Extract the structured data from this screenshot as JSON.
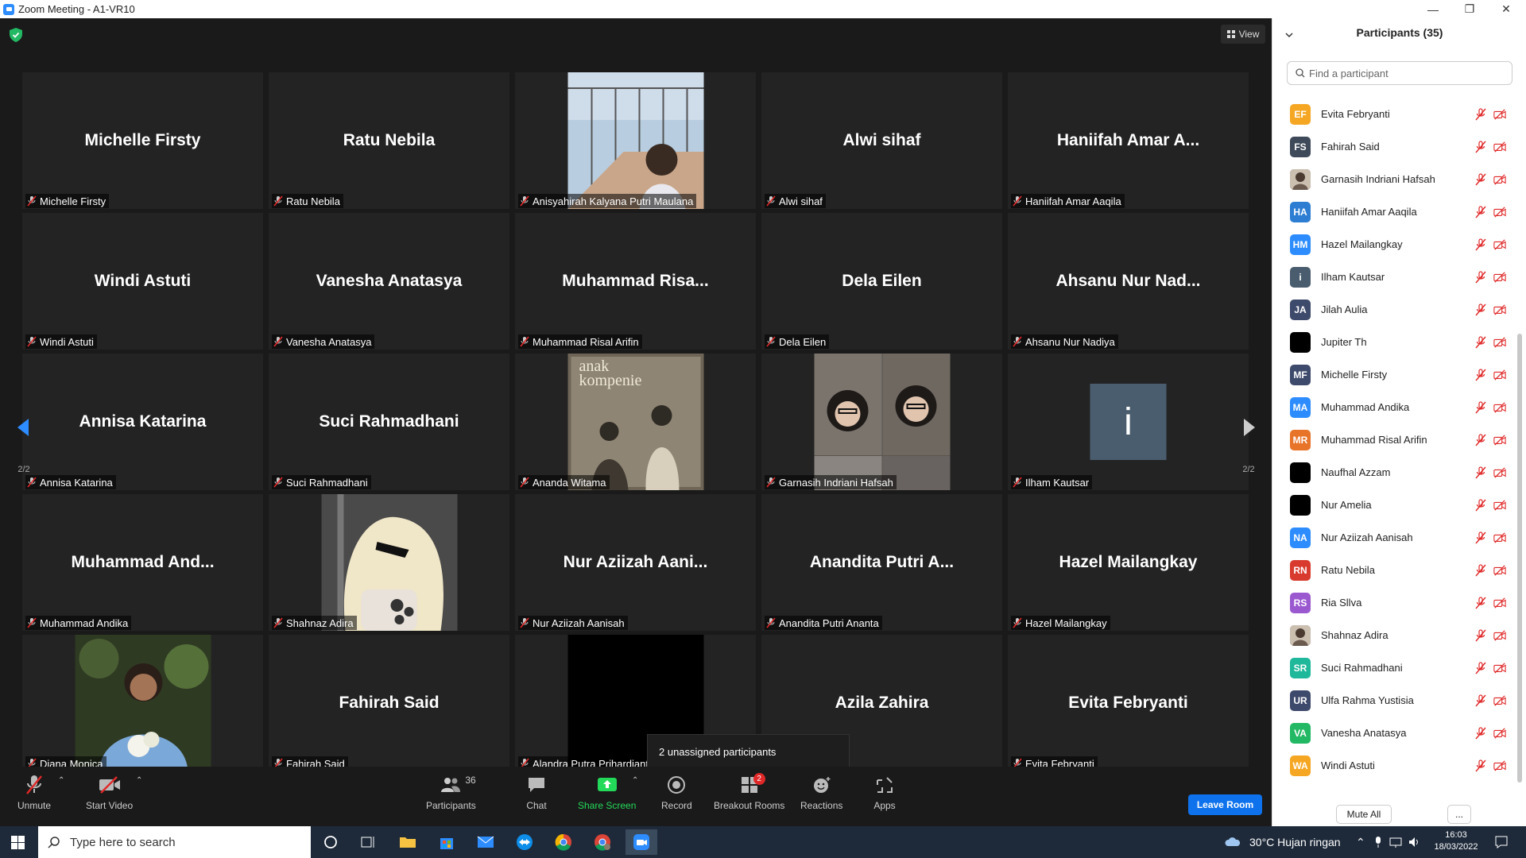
{
  "window": {
    "title": "Zoom Meeting - A1-VR10"
  },
  "meeting": {
    "view_label": "View",
    "page_indicator": "2/2",
    "tiles": [
      {
        "big": "Michelle Firsty",
        "label": "Michelle Firsty"
      },
      {
        "big": "Ratu Nebila",
        "label": "Ratu Nebila"
      },
      {
        "big": "",
        "label": "Anisyahirah Kalyana Putri Maulana"
      },
      {
        "big": "Alwi sihaf",
        "label": "Alwi sihaf"
      },
      {
        "big": "Haniifah Amar A...",
        "label": "Haniifah Amar Aaqila"
      },
      {
        "big": "Windi Astuti",
        "label": "Windi Astuti"
      },
      {
        "big": "Vanesha Anatasya",
        "label": "Vanesha Anatasya"
      },
      {
        "big": "Muhammad Risa...",
        "label": "Muhammad Risal Arifin"
      },
      {
        "big": "Dela Eilen",
        "label": "Dela Eilen"
      },
      {
        "big": "Ahsanu Nur Nad...",
        "label": "Ahsanu Nur Nadiya"
      },
      {
        "big": "Annisa Katarina",
        "label": "Annisa Katarina"
      },
      {
        "big": "Suci Rahmadhani",
        "label": "Suci Rahmadhani"
      },
      {
        "big": "",
        "label": "Ananda Witama",
        "overlay_title": "anak kompenie"
      },
      {
        "big": "",
        "label": "Garnasih Indriani Hafsah"
      },
      {
        "big": "",
        "label": "Ilham Kautsar",
        "avatar_letter": "i"
      },
      {
        "big": "Muhammad And...",
        "label": "Muhammad Andika"
      },
      {
        "big": "",
        "label": "Shahnaz Adira"
      },
      {
        "big": "Nur Aziizah Aani...",
        "label": "Nur Aziizah Aanisah"
      },
      {
        "big": "Anandita Putri A...",
        "label": "Anandita Putri Ananta"
      },
      {
        "big": "Hazel Mailangkay",
        "label": "Hazel Mailangkay"
      },
      {
        "big": "",
        "label": "Diana Monica"
      },
      {
        "big": "Fahirah Said",
        "label": "Fahirah Said"
      },
      {
        "big": "",
        "label": "Alandra Putra Prihardiant"
      },
      {
        "big": "Azila Zahira",
        "label": ""
      },
      {
        "big": "Evita Febryanti",
        "label": "Evita Febryanti"
      }
    ],
    "tooltip": "2 unassigned participants"
  },
  "toolbar": {
    "unmute": "Unmute",
    "start_video": "Start Video",
    "participants": "Participants",
    "participants_count": "36",
    "chat": "Chat",
    "share_screen": "Share Screen",
    "record": "Record",
    "breakout_rooms": "Breakout Rooms",
    "breakout_badge": "2",
    "reactions": "Reactions",
    "apps": "Apps",
    "leave_room": "Leave Room"
  },
  "colors": {
    "accent": "#0e72ed",
    "share_green": "#23d959",
    "mute_red": "#e02828"
  },
  "participants_panel": {
    "title": "Participants (35)",
    "search_placeholder": "Find a participant",
    "mute_all": "Mute All",
    "more": "...",
    "list": [
      {
        "initials": "EF",
        "name": "Evita Febryanti",
        "color": "#f5a623",
        "photo": false
      },
      {
        "initials": "FS",
        "name": "Fahirah Said",
        "color": "#3e4a59",
        "photo": false
      },
      {
        "initials": "",
        "name": "Garnasih Indriani Hafsah",
        "color": "#6b5b4f",
        "photo": true
      },
      {
        "initials": "HA",
        "name": "Haniifah Amar Aaqila",
        "color": "#2d7dd2",
        "photo": false
      },
      {
        "initials": "HM",
        "name": "Hazel Mailangkay",
        "color": "#2d8cff",
        "photo": false
      },
      {
        "initials": "i",
        "name": "Ilham Kautsar",
        "color": "#4a5d6e",
        "photo": false
      },
      {
        "initials": "JA",
        "name": "Jilah Aulia",
        "color": "#3e4a6b",
        "photo": false
      },
      {
        "initials": "",
        "name": "Jupiter Th",
        "color": "#000000",
        "photo": false
      },
      {
        "initials": "MF",
        "name": "Michelle Firsty",
        "color": "#3e4a6b",
        "photo": false
      },
      {
        "initials": "MA",
        "name": "Muhammad Andika",
        "color": "#2d8cff",
        "photo": false
      },
      {
        "initials": "MR",
        "name": "Muhammad Risal Arifin",
        "color": "#e8742a",
        "photo": false
      },
      {
        "initials": "",
        "name": "Naufhal Azzam",
        "color": "#000000",
        "photo": false
      },
      {
        "initials": "",
        "name": "Nur Amelia",
        "color": "#000000",
        "photo": false
      },
      {
        "initials": "NA",
        "name": "Nur Aziizah Aanisah",
        "color": "#2d8cff",
        "photo": false
      },
      {
        "initials": "RN",
        "name": "Ratu Nebila",
        "color": "#d83b2e",
        "photo": false
      },
      {
        "initials": "RS",
        "name": "Ria Sllva",
        "color": "#9b59d0",
        "photo": false
      },
      {
        "initials": "",
        "name": "Shahnaz Adira",
        "color": "#8a7a6a",
        "photo": true
      },
      {
        "initials": "SR",
        "name": "Suci Rahmadhani",
        "color": "#1fb89a",
        "photo": false
      },
      {
        "initials": "UR",
        "name": "Ulfa Rahma Yustisia",
        "color": "#3e4a6b",
        "photo": false
      },
      {
        "initials": "VA",
        "name": "Vanesha Anatasya",
        "color": "#23b863",
        "photo": false
      },
      {
        "initials": "WA",
        "name": "Windi Astuti",
        "color": "#f5a623",
        "photo": false
      }
    ]
  },
  "taskbar": {
    "search_placeholder": "Type here to search",
    "weather": "30°C  Hujan ringan",
    "time": "16:03",
    "date": "18/03/2022"
  }
}
